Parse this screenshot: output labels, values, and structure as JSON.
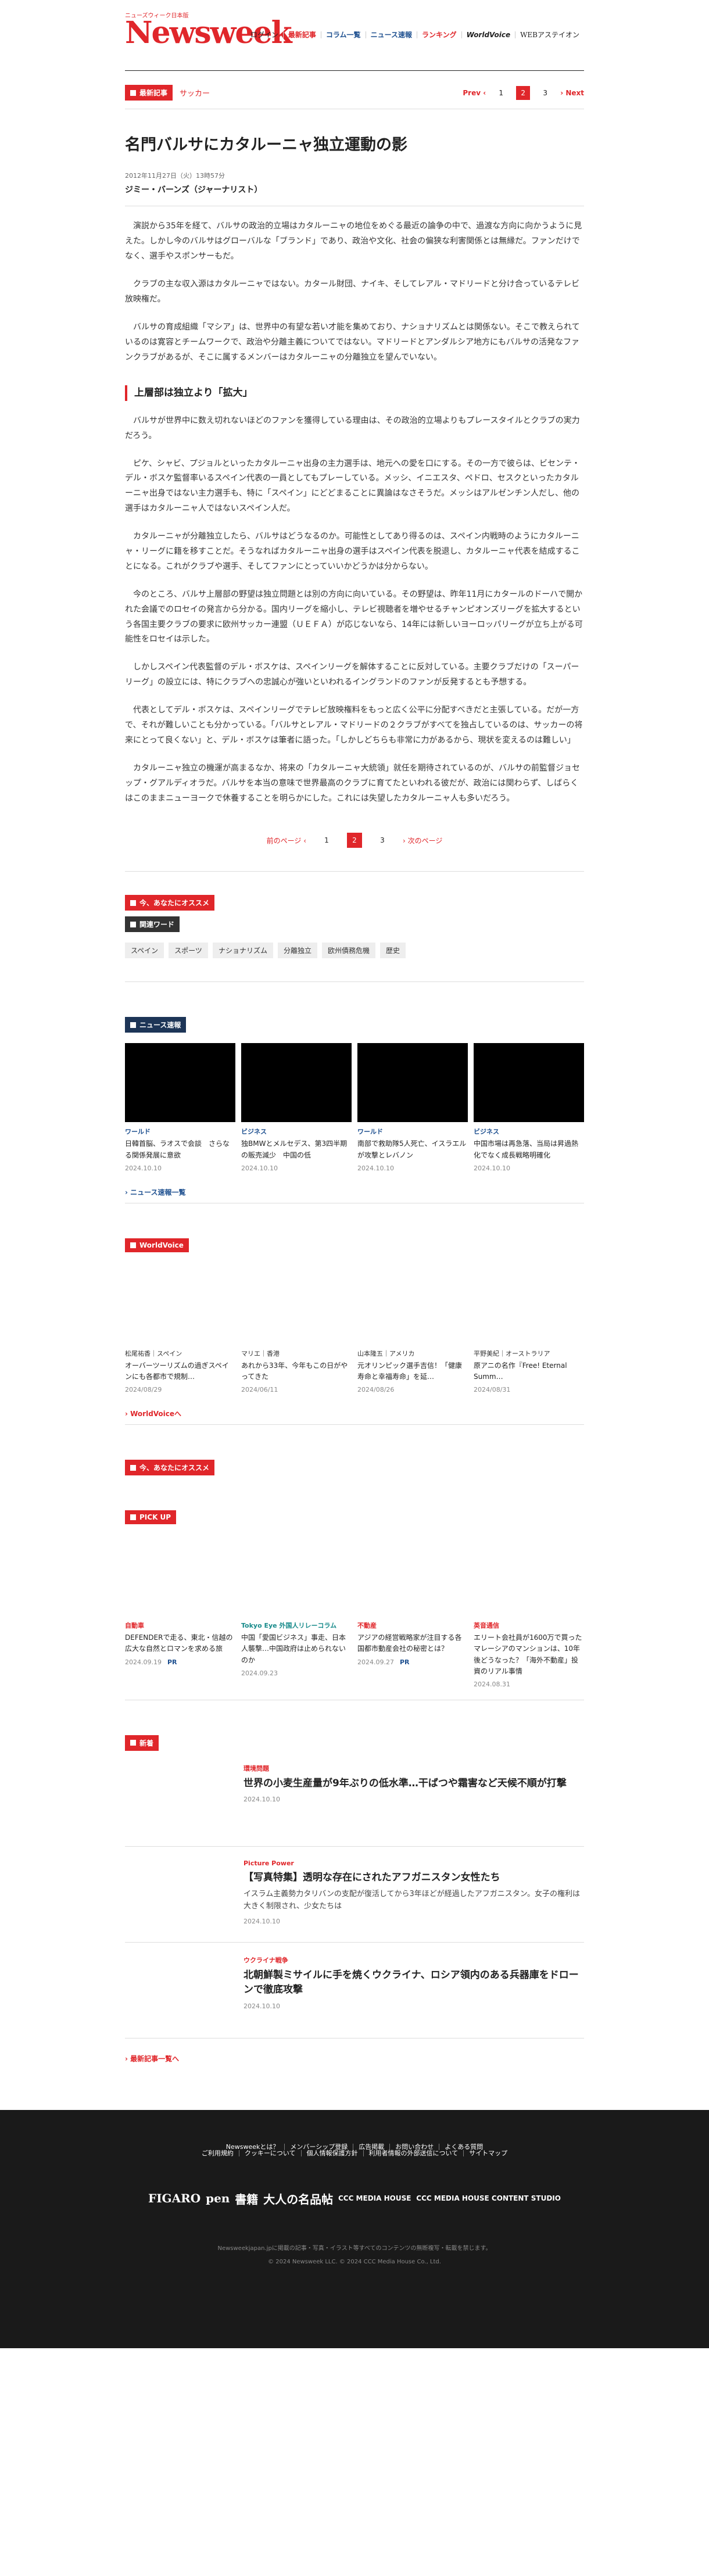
{
  "header": {
    "tagline": "ニューズウィーク日本版",
    "logo": "Newsweek",
    "nav": [
      "ログイン",
      "最新記事",
      "コラム一覧",
      "ニュース速報",
      "ランキング",
      "WorldVoice",
      "WEBアステイオン"
    ]
  },
  "crumb": {
    "badge": "最新記事",
    "category": "サッカー",
    "prev": "Prev",
    "pages": [
      "1",
      "2",
      "3"
    ],
    "active_page": "2",
    "next": "Next"
  },
  "article": {
    "title": "名門バルサにカタルーニャ独立運動の影",
    "date": "2012年11月27日（火）13時57分",
    "author": "ジミー・バーンズ（ジャーナリスト）",
    "paragraphs_a": [
      "演説から35年を経て、バルサの政治的立場はカタルーニャの地位をめぐる最近の論争の中で、過渡な方向に向かうように見えた。しかし今のバルサはグローバルな「ブランド」であり、政治や文化、社会の偏狭な利害関係とは無縁だ。ファンだけでなく、選手やスポンサーもだ。",
      "クラブの主な収入源はカタルーニャではない。カタール財団、ナイキ、そしてレアル・マドリードと分け合っているテレビ放映権だ。",
      "バルサの育成組織「マシア」は、世界中の有望な若い才能を集めており、ナショナリズムとは関係ない。そこで教えられているのは寛容とチームワークで、政治や分離主義についてではない。マドリードとアンダルシア地方にもバルサの活発なファンクラブがあるが、そこに属するメンバーはカタルーニャの分離独立を望んでいない。"
    ],
    "subhead": "上層部は独立より「拡大」",
    "paragraphs_b": [
      "バルサが世界中に数え切れないほどのファンを獲得している理由は、その政治的立場よりもプレースタイルとクラブの実力だろう。",
      "ピケ、シャビ、プジョルといったカタルーニャ出身の主力選手は、地元への愛を口にする。その一方で彼らは、ビセンテ・デル・ボスケ監督率いるスペイン代表の一員としてもプレーしている。メッシ、イニエスタ、ペドロ、セスクといったカタルーニャ出身ではない主力選手も、特に「スペイン」にどどまることに異論はなさそうだ。メッシはアルゼンチン人だし、他の選手はカタルーニャ人ではないスペイン人だ。",
      "カタルーニャが分離独立したら、バルサはどうなるのか。可能性としてあり得るのは、スペイン内戦時のようにカタルーニャ・リーグに籍を移すことだ。そうなればカタルーニャ出身の選手はスペイン代表を脱退し、カタルーニャ代表を結成することになる。これがクラブや選手、そしてファンにとっていいかどうかは分からない。",
      "今のところ、バルサ上層部の野望は独立問題とは別の方向に向いている。その野望は、昨年11月にカタールのドーハで開かれた会議でのロセイの発言から分かる。国内リーグを縮小し、テレビ視聴者を増やせるチャンピオンズリーグを拡大するという各国主要クラブの要求に欧州サッカー連盟（ＵＥＦＡ）が応じないなら、14年には新しいヨーロッパリーグが立ち上がる可能性をロセイは示した。",
      "しかしスペイン代表監督のデル・ボスケは、スペインリーグを解体することに反対している。主要クラブだけの「スーパーリーグ」の設立には、特にクラブへの忠誠心が強いといわれるイングランドのファンが反発するとも予想する。",
      "代表としてデル・ボスケは、スペインリーグでテレビ放映権料をもっと広く公平に分配すべきだと主張している。だが一方で、それが難しいことも分かっている。「バルサとレアル・マドリードの２クラブがすべてを独占しているのは、サッカーの将来にとって良くない」と、デル・ボスケは筆者に語った。「しかしどちらも非常に力があるから、現状を変えるのは難しい」",
      "カタルーニャ独立の機運が高まるなか、将来の「カタルーニャ大統領」就任を期待されているのが、バルサの前監督ジョセップ・グアルディオラだ。バルサを本当の意味で世界最高のクラブに育てたといわれる彼だが、政治には関わらず、しばらくはこのままニューヨークで休養することを明らかにした。これには失望したカタルーニャ人も多いだろう。"
    ]
  },
  "pager2": {
    "prev": "前のページ",
    "pages": [
      "1",
      "2",
      "3"
    ],
    "active": "2",
    "next": "次のページ"
  },
  "recommend": {
    "badge": "今、あなたにオススメ"
  },
  "keywords": {
    "badge": "関連ワード",
    "tags": [
      "スペイン",
      "スポーツ",
      "ナショナリズム",
      "分離独立",
      "欧州債務危機",
      "歴史"
    ]
  },
  "news": {
    "badge": "ニュース速報",
    "items": [
      {
        "cat": "ワールド",
        "title": "日韓首脳、ラオスで会談　さらなる関係発展に意欲",
        "date": "2024.10.10"
      },
      {
        "cat": "ビジネス",
        "title": "独BMWとメルセデス、第3四半期の販売減少　中国の低",
        "date": "2024.10.10"
      },
      {
        "cat": "ワールド",
        "title": "南部で救助隊5人死亡、イスラエルが攻撃とレバノン",
        "date": "2024.10.10"
      },
      {
        "cat": "ビジネス",
        "title": "中国市場は再急落、当局は昇過熱化でなく成長戦略明確化",
        "date": "2024.10.10"
      }
    ],
    "more": "ニュース速報一覧"
  },
  "worldvoice": {
    "badge": "WorldVoice",
    "items": [
      {
        "who": "松尾祐香｜スペイン",
        "title": "オーバーツーリズムの過ぎスペインにも各都市で規制…",
        "date": "2024/08/29"
      },
      {
        "who": "マリエ｜香港",
        "title": "あれから33年、今年もこの日がやってきた",
        "date": "2024/06/11"
      },
      {
        "who": "山本隆五｜アメリカ",
        "title": "元オリンピック選手吉信！「健康寿命と幸福寿命」を延…",
        "date": "2024/08/26"
      },
      {
        "who": "平野美紀｜オーストラリア",
        "title": "原アニの名作『Free! Eternal Summ…",
        "date": "2024/08/31"
      }
    ],
    "more": "WorldVoiceへ"
  },
  "recommend2": {
    "badge": "今、あなたにオススメ"
  },
  "pickup": {
    "badge": "PICK UP",
    "items": [
      {
        "cat": "自動車",
        "title": "DEFENDERで走る、東北・信越の広大な自然とロマンを求める旅",
        "date": "2024.09.19",
        "pr": "PR"
      },
      {
        "cat": "Tokyo Eye 外国人リレーコラム",
        "title": "中国「愛国ビジネス」事走、日本人襲撃…中国政府は止められないのか",
        "date": "2024.09.23",
        "pr": ""
      },
      {
        "cat": "不動産",
        "title": "アジアの経営戦略家が注目する各国都市動産会社の秘密とは？",
        "date": "2024.09.27",
        "pr": "PR"
      },
      {
        "cat": "英音通信",
        "title": "エリート会社員が1600万で買ったマレーシアのマンションは、10年後どうなった？「海外不動産」投資のリアル事情",
        "date": "2024.08.31",
        "pr": ""
      }
    ]
  },
  "latest": {
    "badge": "新着",
    "items": [
      {
        "cat": "環境問題",
        "title": "世界の小麦生産量が9年ぶりの低水準…干ばつや霜害など天候不順が打撃",
        "sub": "",
        "date": "2024.10.10"
      },
      {
        "cat": "Picture Power",
        "title": "【写真特集】透明な存在にされたアフガニスタン女性たち",
        "sub": "イスラム主義勢力タリバンの支配が復活してから3年ほどが経過したアフガニスタン。女子の権利は大きく制限され、少女たちは",
        "date": "2024.10.10"
      },
      {
        "cat": "ウクライナ戦争",
        "title": "北朝鮮製ミサイルに手を焼くウクライナ、ロシア領内のある兵器庫をドローンで徹底攻撃",
        "sub": "",
        "date": "2024.10.10"
      }
    ],
    "more": "最新記事一覧へ"
  },
  "footer": {
    "links_a": [
      "Newsweekとは？",
      "メンバーシップ登録",
      "広告掲載",
      "お問い合わせ",
      "よくある質問"
    ],
    "links_b": [
      "ご利用規約",
      "クッキーについて",
      "個人情報保護方針",
      "利用者情報の外部送信について",
      "サイトマップ"
    ],
    "brands": [
      "FIGARO",
      "pen",
      "書籍",
      "大人の名品帖",
      "CCC MEDIA HOUSE",
      "CCC MEDIA HOUSE CONTENT STUDIO"
    ],
    "note": "Newsweekjapan.jpに掲載の記事・写真・イラスト等すべてのコンテンツの無断複写・転載を禁じます。",
    "copy": "© 2024 Newsweek LLC. © 2024 CCC Media House Co., Ltd."
  }
}
